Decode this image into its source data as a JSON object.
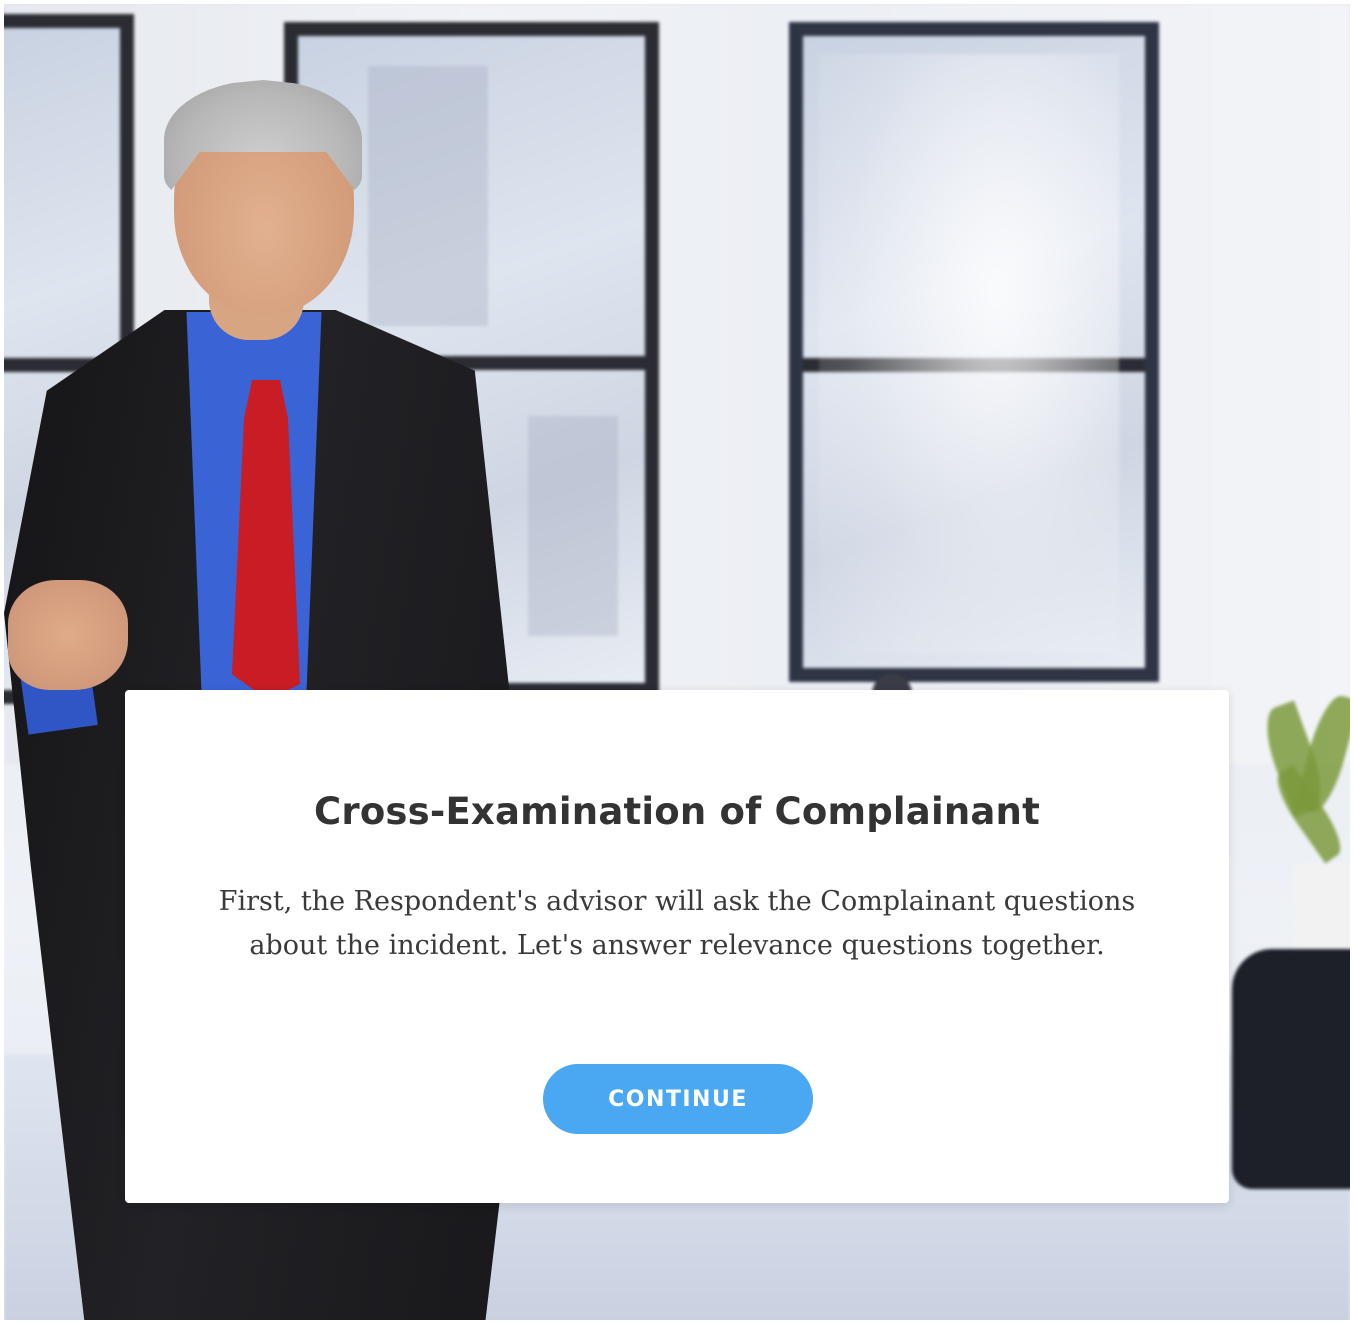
{
  "dialog": {
    "title": "Cross-Examination of Complainant",
    "body": "First, the Respondent's advisor will ask the Complainant questions about the incident. Let's answer relevance questions together.",
    "continue_label": "CONTINUE"
  },
  "colors": {
    "button_background": "#4aa8f2",
    "button_text": "#ffffff",
    "title_text": "#333333",
    "card_background": "#ffffff"
  },
  "media": {
    "background": "office-background-image",
    "presenter": "presenter-image"
  }
}
